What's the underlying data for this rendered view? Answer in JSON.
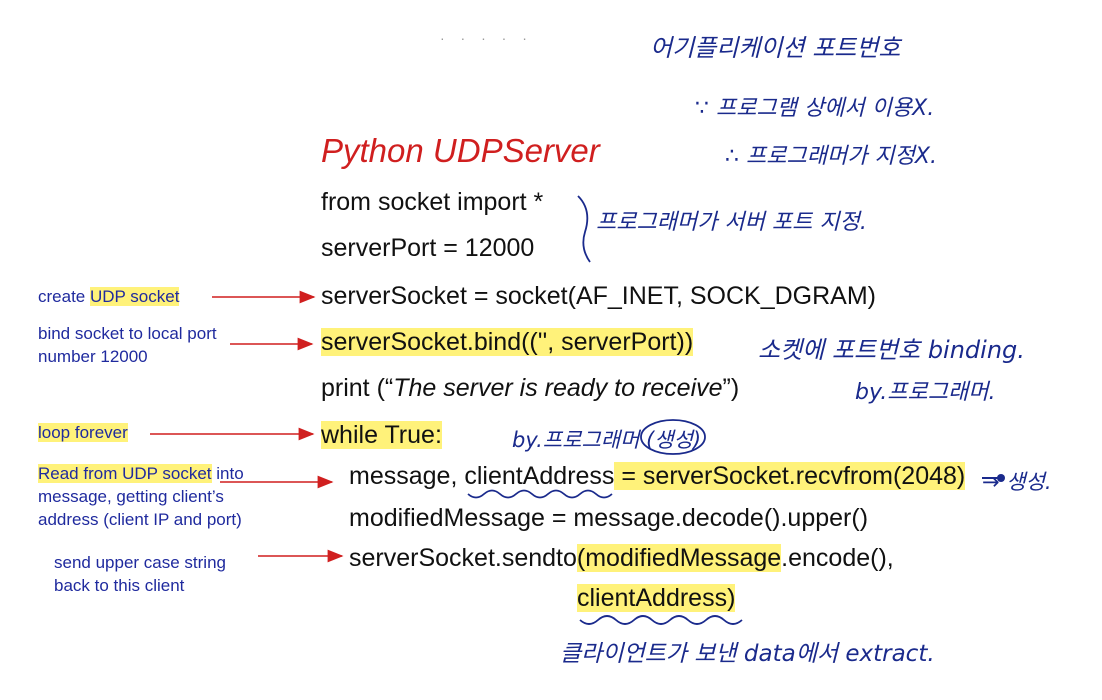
{
  "title": "Python UDPServer",
  "code": {
    "line1": "from socket import *",
    "line2": "serverPort = 12000",
    "line3": "serverSocket = socket(AF_INET, SOCK_DGRAM)",
    "line4": "serverSocket.bind(('', serverPort))",
    "line5_pre": "print (“",
    "line5_italic": "The server is ready to receive",
    "line5_post": "”)",
    "line6": "while True:",
    "line7_pre": "message, ",
    "line7_var": "clientAddress",
    "line7_mid": " = ",
    "line7_call": "serverSocket.recvfrom(2048)",
    "line8": "modifiedMessage = message.decode().upper()",
    "line9_pre": "serverSocket.sendto",
    "line9_hl": "(modifiedMessage",
    "line9_post": ".encode(),",
    "line10": "clientAddress)"
  },
  "annotations": {
    "create_pre": "create ",
    "create_hl": "UDP socket",
    "bind_1": "bind socket to local port",
    "bind_2": "number 12000",
    "loop": "loop forever",
    "read_hl": "Read from UDP socket",
    "read_1": " into",
    "read_2": "message, getting client’s",
    "read_3": "address (client IP and port)",
    "send_1": "send upper case string",
    "send_2": "back to this client"
  },
  "handwriting": {
    "note_top": "어기플리케이션 포트번호",
    "note_2": "∵ 프로그램 상에서 이용X.",
    "note_3": "∴ 프로그래머가 지정X.",
    "note_port": "프로그래머가 서버 포트 지정.",
    "note_bind": "소켓에 포트번호 binding.",
    "note_bind_by": "by.프로그래머.",
    "note_while": "by.프로그래머 (생성)",
    "note_recv": "→ 생성.",
    "note_extract": "클라이언트가 보낸 data에서 extract."
  },
  "colors": {
    "title": "#d01f1f",
    "annotation": "#1f2a9e",
    "highlight": "#fff27a",
    "arrow": "#d01f1f",
    "handwriting": "#1a2a8c"
  }
}
